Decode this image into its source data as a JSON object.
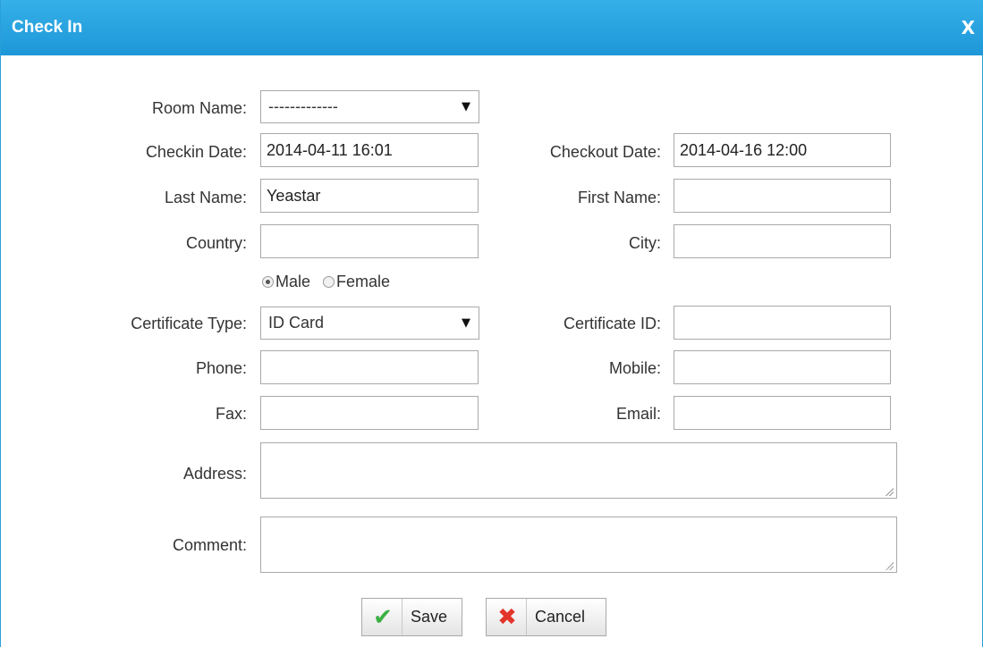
{
  "dialog": {
    "title": "Check In",
    "close_label": "X"
  },
  "form": {
    "room_name": {
      "label": "Room Name:",
      "value": "-------------"
    },
    "checkin_date": {
      "label": "Checkin Date:",
      "value": "2014-04-11 16:01"
    },
    "checkout_date": {
      "label": "Checkout Date:",
      "value": "2014-04-16 12:00"
    },
    "last_name": {
      "label": "Last Name:",
      "value": "Yeastar"
    },
    "first_name": {
      "label": "First Name:",
      "value": ""
    },
    "country": {
      "label": "Country:",
      "value": ""
    },
    "city": {
      "label": "City:",
      "value": ""
    },
    "gender": {
      "male_label": "Male",
      "female_label": "Female",
      "selected": "Male"
    },
    "certificate_type": {
      "label": "Certificate Type:",
      "value": "ID Card"
    },
    "certificate_id": {
      "label": "Certificate ID:",
      "value": ""
    },
    "phone": {
      "label": "Phone:",
      "value": ""
    },
    "mobile": {
      "label": "Mobile:",
      "value": ""
    },
    "fax": {
      "label": "Fax:",
      "value": ""
    },
    "email": {
      "label": "Email:",
      "value": ""
    },
    "address": {
      "label": "Address:",
      "value": ""
    },
    "comment": {
      "label": "Comment:",
      "value": ""
    }
  },
  "buttons": {
    "save_label": "Save",
    "cancel_label": "Cancel"
  },
  "colors": {
    "titlebar": "#1e97d8",
    "save_icon": "#3cb043",
    "cancel_icon": "#e2352b"
  },
  "icons": {
    "save": "checkmark-icon",
    "cancel": "cross-icon"
  }
}
